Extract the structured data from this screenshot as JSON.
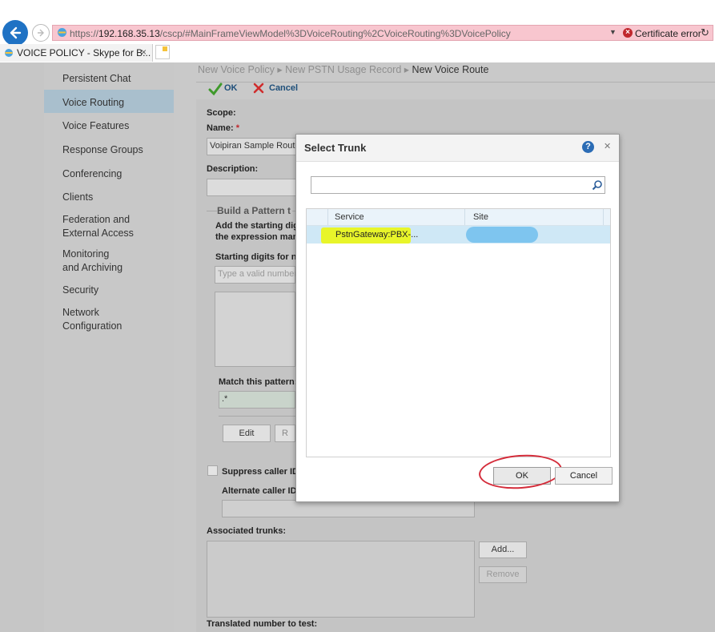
{
  "browser": {
    "url_prefix": "https://",
    "url_host": "192.168.35.13",
    "url_path": "/cscp/#MainFrameViewModel%3DVoiceRouting%2CVoiceRouting%3DVoicePolicy",
    "certificate_error": "Certificate error",
    "tab_title": "VOICE POLICY - Skype for B...",
    "tab_close": "×"
  },
  "sidebar": {
    "items": [
      {
        "label": "Persistent Chat"
      },
      {
        "label": "Voice Routing",
        "active": true
      },
      {
        "label": "Voice Features"
      },
      {
        "label": "Response Groups"
      },
      {
        "label": "Conferencing"
      },
      {
        "label": "Clients"
      },
      {
        "label": "Federation and",
        "label2": "External Access"
      },
      {
        "label": "Monitoring",
        "label2": "and Archiving"
      },
      {
        "label": "Security"
      },
      {
        "label": "Network",
        "label2": "Configuration"
      }
    ]
  },
  "breadcrumb": {
    "items": [
      "New Voice Policy",
      "New PSTN Usage Record"
    ],
    "current": "New Voice Route"
  },
  "toolbar": {
    "ok_label": "OK",
    "cancel_label": "Cancel"
  },
  "form": {
    "scope_label": "Scope:",
    "name_label": "Name:",
    "required_mark": "*",
    "name_value": "Voipiran Sample Route",
    "description_label": "Description:",
    "pattern_section_title": "Build a Pattern t",
    "pattern_help_line1": "Add the starting dig",
    "pattern_help_line2": "the expression manu",
    "starting_digits_label": "Starting digits for n",
    "starting_digits_placeholder": "Type a valid number",
    "match_pattern_label": "Match this pattern:",
    "match_pattern_value": ".*",
    "edit_button": "Edit",
    "remove_button_partial": "R",
    "suppress_label": "Suppress caller ID",
    "alternate_label": "Alternate caller ID:",
    "associated_trunks_label": "Associated trunks:",
    "add_button": "Add...",
    "remove_button": "Remove",
    "translated_label": "Translated number to test:"
  },
  "dialog": {
    "title": "Select Trunk",
    "help": "?",
    "close": "✕",
    "search_value": "",
    "columns": [
      "Service",
      "Site"
    ],
    "rows": [
      {
        "service": "PstnGateway:PBX-...",
        "site": ""
      }
    ],
    "ok_label": "OK",
    "cancel_label": "Cancel"
  },
  "colors": {
    "accent": "#1f72c4",
    "highlight": "#e8f52a",
    "annotation": "#d42c3a"
  }
}
